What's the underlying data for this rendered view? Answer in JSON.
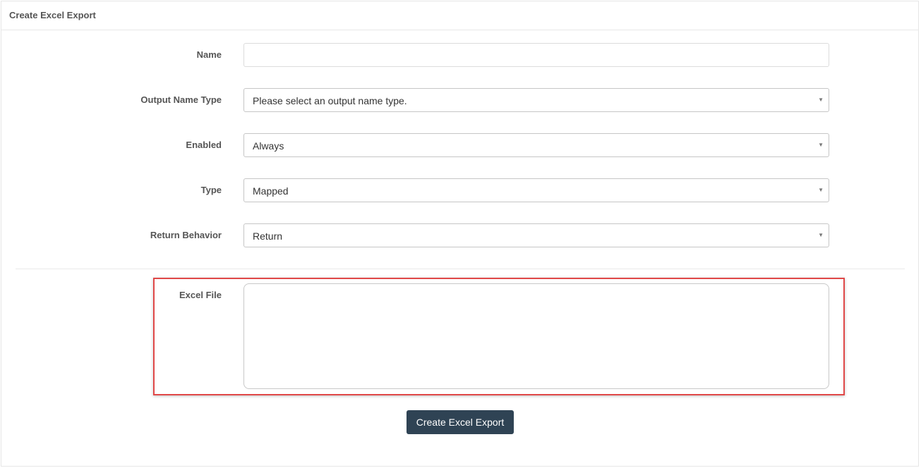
{
  "panel": {
    "title": "Create Excel Export"
  },
  "form": {
    "name": {
      "label": "Name",
      "value": ""
    },
    "output_name_type": {
      "label": "Output Name Type",
      "value": "Please select an output name type."
    },
    "enabled": {
      "label": "Enabled",
      "value": "Always"
    },
    "type": {
      "label": "Type",
      "value": "Mapped"
    },
    "return_behavior": {
      "label": "Return Behavior",
      "value": "Return"
    },
    "excel_file": {
      "label": "Excel File",
      "value": ""
    }
  },
  "actions": {
    "submit_label": "Create Excel Export"
  },
  "icons": {
    "select_caret": "caret-down-icon"
  },
  "colors": {
    "button_bg": "#2f4354",
    "highlight_border": "#e04848"
  }
}
